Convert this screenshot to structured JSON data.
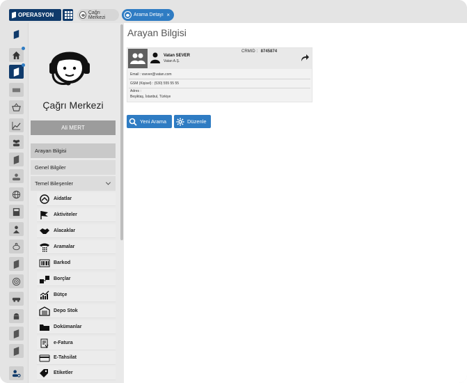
{
  "topbar": {
    "brand": "OPERASYON",
    "tabs": [
      {
        "label": "Çağrı Merkezi"
      },
      {
        "label": "Arama Detayı",
        "close": "×"
      }
    ]
  },
  "rail": {
    "icons": [
      "logo-icon",
      "home-icon",
      "module-icon",
      "cards-icon",
      "basket-icon",
      "chart-line-icon",
      "people-icon",
      "module2-icon",
      "team-icon",
      "globe-icon",
      "calculator-icon",
      "org-icon",
      "piggy-bank-icon",
      "target-icon",
      "truck-icon",
      "android-icon",
      "module3-icon",
      "module4-icon",
      "user-settings-icon"
    ]
  },
  "sidebar": {
    "title": "Çağrı Merkezi",
    "user": "Ali MERT",
    "menu": [
      {
        "label": "Arayan Bilgisi"
      },
      {
        "label": "Genel Bilgiler"
      },
      {
        "label": "Temel Bileşenler"
      }
    ],
    "sub_items": [
      {
        "label": "Aidatlar",
        "icon": "aidat-icon"
      },
      {
        "label": "Aktiviteler",
        "icon": "flag-icon"
      },
      {
        "label": "Alacaklar",
        "icon": "handshake-icon"
      },
      {
        "label": "Aramalar",
        "icon": "phone-icon"
      },
      {
        "label": "Barkod",
        "icon": "barcode-icon"
      },
      {
        "label": "Borçlar",
        "icon": "debt-icon"
      },
      {
        "label": "Bütçe",
        "icon": "budget-icon"
      },
      {
        "label": "Depo Stok",
        "icon": "warehouse-icon"
      },
      {
        "label": "Dokümanlar",
        "icon": "folder-icon"
      },
      {
        "label": "e-Fatura",
        "icon": "invoice-icon"
      },
      {
        "label": "E-Tahsilat",
        "icon": "credit-card-icon"
      },
      {
        "label": "Etiketler",
        "icon": "tags-icon"
      }
    ]
  },
  "main": {
    "title": "Arayan Bilgisi",
    "caller": {
      "name": "Vatan SEVER",
      "company": "Vatan A.Ş.",
      "crmid_label": "CRMID :",
      "crmid": "8745874",
      "email": "Email : vsever@vatan.com",
      "gsm": "GSM (Kişisel) : (530) 555 55 55",
      "address_label": "Adres :",
      "address": "Beşiktaş, İstanbul, Türkiye"
    },
    "buttons": {
      "new_call": "Yeni Arama",
      "edit": "Düzenle"
    }
  },
  "colors": {
    "navy": "#0f3a6b",
    "accent": "#2f7cc3",
    "rail_bg": "#e4e4e4"
  }
}
